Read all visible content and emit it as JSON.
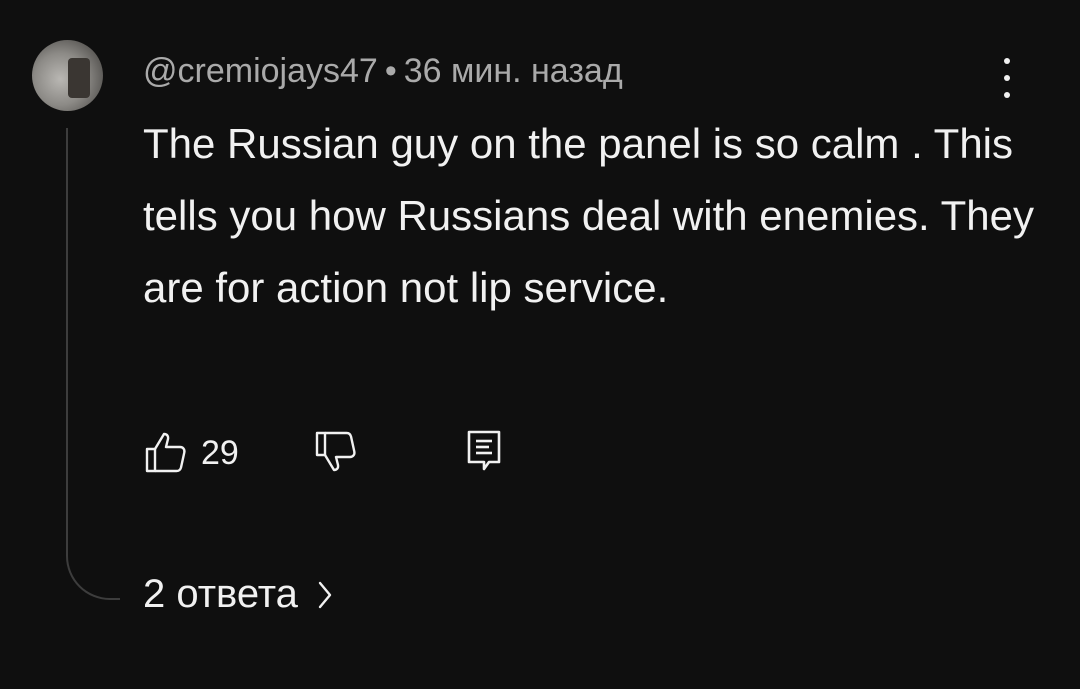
{
  "comment": {
    "author": "@cremiojays47",
    "separator": "•",
    "time": "36 мин. назад",
    "text": "The Russian guy on the panel is so calm . This tells you how Russians deal with enemies. They are for action not lip service.",
    "like_count": "29",
    "replies_label": "2 ответа"
  },
  "icons": {
    "like": "thumbs-up-icon",
    "dislike": "thumbs-down-icon",
    "reply": "reply-comment-icon",
    "more": "more-vertical-icon",
    "chevron": "chevron-right-icon"
  },
  "colors": {
    "background": "#0f0f0f",
    "text_primary": "#f1f1f1",
    "text_secondary": "#aaaaaa",
    "thread_line": "#3d3d3d"
  }
}
